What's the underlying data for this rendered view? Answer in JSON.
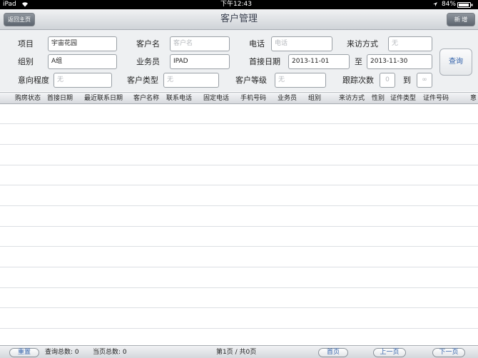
{
  "status_bar": {
    "device": "iPad",
    "time": "下午12:43",
    "battery": "84%"
  },
  "nav": {
    "back_label": "返回主页",
    "title": "客户管理",
    "new_label": "新 增"
  },
  "form": {
    "project": {
      "label": "项目",
      "value": "宇宙花园"
    },
    "customer_name": {
      "label": "客户名",
      "placeholder": "客户名"
    },
    "phone": {
      "label": "电话",
      "placeholder": "电话"
    },
    "visit_method": {
      "label": "来访方式",
      "placeholder": "无"
    },
    "group": {
      "label": "组别",
      "value": "A组"
    },
    "salesperson": {
      "label": "业务员",
      "value": "IPAD"
    },
    "first_date": {
      "label": "首接日期",
      "value": "2013-11-01"
    },
    "to_label": "至",
    "end_date": {
      "value": "2013-11-30"
    },
    "query_label": "查询",
    "intent": {
      "label": "意向程度",
      "placeholder": "无"
    },
    "customer_type": {
      "label": "客户类型",
      "placeholder": "无"
    },
    "customer_level": {
      "label": "客户等级",
      "placeholder": "无"
    },
    "follow_count": {
      "label": "跟踪次数",
      "min_placeholder": "0",
      "to_label": "到",
      "max_placeholder": "∞"
    }
  },
  "table": {
    "headers": [
      "购房状态",
      "首接日期",
      "最近联系日期",
      "客户名称",
      "联系电话",
      "固定电话",
      "手机号码",
      "业务员",
      "组别",
      "来访方式",
      "性别",
      "证件类型",
      "证件号码",
      "意"
    ],
    "rows": []
  },
  "footer": {
    "reset_label": "重置",
    "query_total": "查询总数: 0",
    "page_total": "当页总数: 0",
    "page_info": "第1页 / 共0页",
    "first_label": "首页",
    "prev_label": "上一页",
    "next_label": "下一页"
  }
}
